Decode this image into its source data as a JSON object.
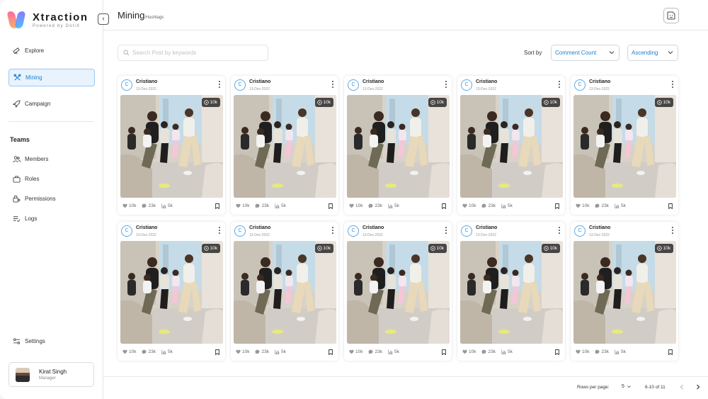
{
  "app": {
    "name": "Xtraction",
    "tagline": "Powered by DotiX",
    "collapse_glyph": "‹"
  },
  "nav": {
    "items": [
      {
        "label": "Explore",
        "icon": "telescope-icon"
      },
      {
        "label": "Mining",
        "icon": "tools-icon",
        "active": true
      },
      {
        "label": "Campaign",
        "icon": "rocket-icon"
      }
    ],
    "teams_heading": "Teams",
    "team_items": [
      {
        "label": "Members",
        "icon": "users-icon"
      },
      {
        "label": "Roles",
        "icon": "briefcase-icon"
      },
      {
        "label": "Permissions",
        "icon": "lock-user-icon"
      },
      {
        "label": "Logs",
        "icon": "list-check-icon"
      }
    ],
    "settings_label": "Settings"
  },
  "profile": {
    "name": "Kirat Singh",
    "role": "Manager"
  },
  "header": {
    "title": "Mining",
    "subtitle": "/Hashtags",
    "action_icon": "sticker-icon"
  },
  "toolbar": {
    "search_placeholder": "Search Post by keywords",
    "sort_label": "Sort by",
    "sort_field": "Comment Count",
    "sort_order": "Ascending"
  },
  "colors": {
    "accent": "#1b7fd6",
    "active_bg": "#e8f3fd"
  },
  "posts": [
    {
      "author": "Cristiano",
      "avatar_letter": "C",
      "date": "13-Dec-2022",
      "views": "10k",
      "likes": "10k",
      "comments": "23k",
      "shares": "5k"
    },
    {
      "author": "Cristiano",
      "avatar_letter": "C",
      "date": "13-Dec-2022",
      "views": "10k",
      "likes": "10k",
      "comments": "23k",
      "shares": "5k"
    },
    {
      "author": "Cristiano",
      "avatar_letter": "C",
      "date": "13-Dec-2022",
      "views": "10k",
      "likes": "10k",
      "comments": "23k",
      "shares": "5k"
    },
    {
      "author": "Cristiano",
      "avatar_letter": "C",
      "date": "13-Dec-2022",
      "views": "10k",
      "likes": "10k",
      "comments": "23k",
      "shares": "5k"
    },
    {
      "author": "Cristiano",
      "avatar_letter": "C",
      "date": "13-Dec-2022",
      "views": "10k",
      "likes": "10k",
      "comments": "23k",
      "shares": "5k"
    },
    {
      "author": "Cristiano",
      "avatar_letter": "C",
      "date": "13-Dec-2022",
      "views": "10k",
      "likes": "10k",
      "comments": "23k",
      "shares": "5k"
    },
    {
      "author": "Cristiano",
      "avatar_letter": "C",
      "date": "13-Dec-2022",
      "views": "10k",
      "likes": "10k",
      "comments": "23k",
      "shares": "5k"
    },
    {
      "author": "Cristiano",
      "avatar_letter": "C",
      "date": "13-Dec-2022",
      "views": "10k",
      "likes": "10k",
      "comments": "23k",
      "shares": "5k"
    },
    {
      "author": "Cristiano",
      "avatar_letter": "C",
      "date": "13-Dec-2022",
      "views": "10k",
      "likes": "10k",
      "comments": "23k",
      "shares": "5k"
    },
    {
      "author": "Cristiano",
      "avatar_letter": "C",
      "date": "13-Dec-2022",
      "views": "10k",
      "likes": "10k",
      "comments": "23k",
      "shares": "5k"
    }
  ],
  "pagination": {
    "rows_label": "Rows per page:",
    "rows_value": "5",
    "range": "6-10 of 11"
  }
}
